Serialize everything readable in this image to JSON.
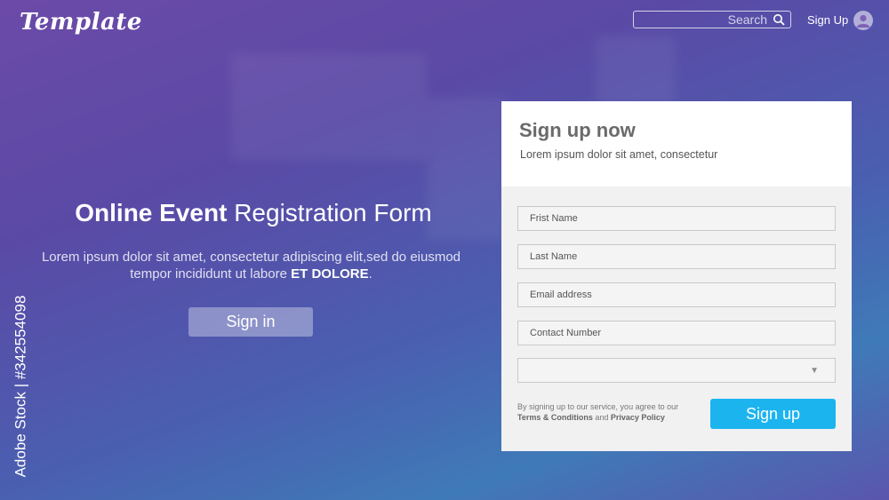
{
  "header": {
    "logo_text": "Template",
    "search_placeholder": "Search",
    "signup_label": "Sign Up"
  },
  "hero": {
    "title_bold": "Online Event",
    "title_rest": " Registration Form",
    "subtitle_line1": "Lorem ipsum dolor sit amet, consectetur adipiscing elit,sed do eiusmod",
    "subtitle_line2": "tempor incididunt ut labore ",
    "subtitle_strong": "ET DOLORE",
    "subtitle_end": ".",
    "signin_label": "Sign in"
  },
  "form": {
    "title": "Sign up now",
    "subtitle": "Lorem ipsum dolor sit amet, consectetur",
    "fields": [
      {
        "placeholder": "Frist Name"
      },
      {
        "placeholder": "Last Name"
      },
      {
        "placeholder": "Email address"
      },
      {
        "placeholder": "Contact Number"
      }
    ],
    "select_value": "",
    "terms_prefix": "By signing up to our service, you agree to our",
    "terms_link": "Terms & Conditions",
    "terms_and": " and ",
    "privacy_link": "Privacy Policy",
    "submit_label": "Sign up"
  },
  "watermark": "Adobe Stock | #342554098",
  "colors": {
    "accent": "#1cb4ef",
    "background_start": "#6c4aa8",
    "background_end": "#3f7ab8"
  },
  "icons": {
    "search": "search-icon",
    "avatar": "user-avatar-icon",
    "caret": "chevron-down-icon"
  }
}
